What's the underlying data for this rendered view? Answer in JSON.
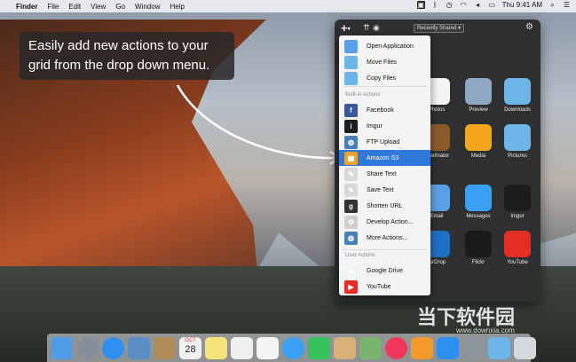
{
  "menubar": {
    "apple": "",
    "items": [
      "Finder",
      "File",
      "Edit",
      "View",
      "Go",
      "Window",
      "Help"
    ],
    "clock": "Thu 9:41 AM",
    "icons": [
      "app-status-icon",
      "bluetooth-icon",
      "clock-icon",
      "wifi-icon",
      "volume-icon",
      "battery-icon",
      "search-icon",
      "list-icon"
    ]
  },
  "callout": {
    "line1": "Easily add new actions to your",
    "line2": "grid from the drop down menu."
  },
  "panel": {
    "plus": "+",
    "dropdown": "Recently Shared ▾",
    "gear": "⚙",
    "grid": [
      {
        "label": "Photos",
        "color": "#f5f5f5"
      },
      {
        "label": "Preview",
        "color": "#8fa7c2"
      },
      {
        "label": "Downloads",
        "color": "#6fb6e8"
      },
      {
        "label": "Pixelmator",
        "color": "#8b5a2b"
      },
      {
        "label": "Media",
        "color": "#f2a81a"
      },
      {
        "label": "Pictures",
        "color": "#6fb6e8"
      },
      {
        "label": "Email",
        "color": "#5aa0e6"
      },
      {
        "label": "Messages",
        "color": "#3aa0f5"
      },
      {
        "label": "Imgur",
        "color": "#1d1d1d"
      },
      {
        "label": "AirDrop",
        "color": "#1f6fc4"
      },
      {
        "label": "Flickr",
        "color": "#1a1a1a"
      },
      {
        "label": "YouTube",
        "color": "#e52d27"
      }
    ]
  },
  "menu": {
    "top": [
      {
        "label": "Open Application",
        "color": "#5aa0e6"
      },
      {
        "label": "Move Files",
        "color": "#6fb6e8"
      },
      {
        "label": "Copy Files",
        "color": "#6fb6e8"
      }
    ],
    "builtin_header": "Built-in Actions",
    "builtin": [
      {
        "label": "Facebook",
        "color": "#3b5998",
        "glyph": "f"
      },
      {
        "label": "Imgur",
        "color": "#1d1d1d",
        "glyph": "i"
      },
      {
        "label": "FTP Upload",
        "color": "#4a7fb5",
        "glyph": "◍"
      },
      {
        "label": "Amazon S3",
        "color": "#e8a32c",
        "glyph": "▦"
      },
      {
        "label": "Share Text",
        "color": "#d9d9d9",
        "glyph": "✎"
      },
      {
        "label": "Save Text",
        "color": "#d9d9d9",
        "glyph": "✎"
      },
      {
        "label": "Shorten URL",
        "color": "#333333",
        "glyph": "g"
      },
      {
        "label": "Develop Action...",
        "color": "#cfcfcf",
        "glyph": "⚙"
      },
      {
        "label": "More Actions...",
        "color": "#4a7fb5",
        "glyph": "◍"
      }
    ],
    "user_header": "User Actions",
    "user": [
      {
        "label": "Google Drive",
        "color": "#f4f4f4",
        "glyph": "▲"
      },
      {
        "label": "YouTube",
        "color": "#e52d27",
        "glyph": "▶"
      }
    ],
    "selected": "Amazon S3"
  },
  "dock": {
    "apps": [
      "finder-icon",
      "launchpad-icon",
      "safari-icon",
      "mail-stamp-icon",
      "contacts-icon",
      "calendar-icon",
      "notes-icon",
      "reminders-icon",
      "photos-icon",
      "messages-icon",
      "facetime-icon",
      "books-icon",
      "maps-icon",
      "music-icon",
      "ibooks-icon",
      "app-store-icon",
      "system-preferences-icon",
      "downloads-folder-icon",
      "trash-icon"
    ],
    "colors": [
      "#4f9de6",
      "#888e99",
      "#2f8ff0",
      "#5a8ec4",
      "#b08b57",
      "#f1f1f1",
      "#f6e37a",
      "#f0f0f0",
      "#f5f5f5",
      "#3aa0f5",
      "#35c25a",
      "#d8b27a",
      "#7ab56e",
      "#f0375a",
      "#f39a2a",
      "#2d8ff0",
      "#8f959c",
      "#6fb6e8",
      "#d5d9de"
    ],
    "calendar_month": "OCT",
    "calendar_day": "28"
  },
  "watermark": {
    "text": "当下软件园",
    "url": "www.downxia.com"
  }
}
